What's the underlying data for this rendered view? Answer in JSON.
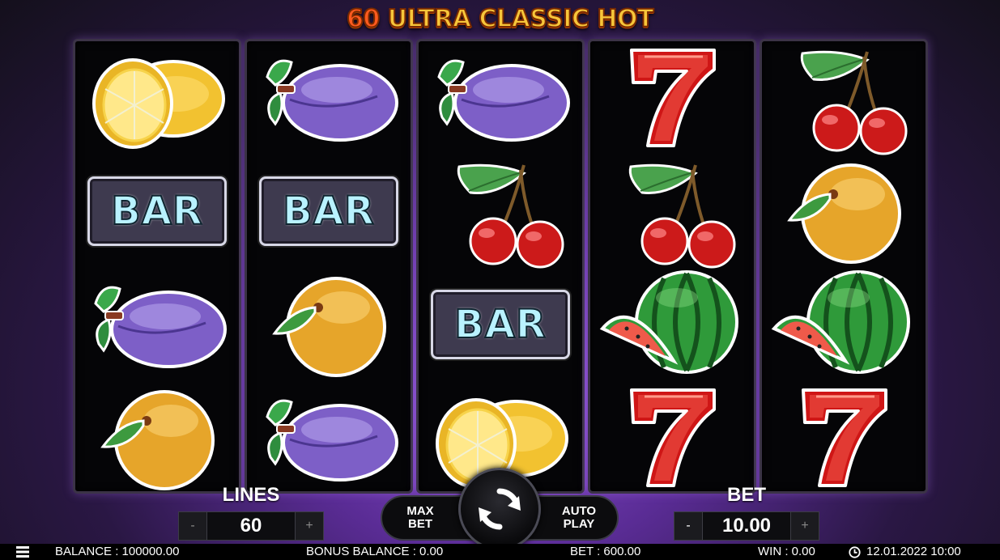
{
  "game": {
    "title_num": "60",
    "title_text": "ULTRA CLASSIC HOT"
  },
  "reels": [
    [
      "lemon",
      "bar",
      "plum",
      "orange"
    ],
    [
      "plum",
      "bar",
      "orange",
      "plum"
    ],
    [
      "plum",
      "cherry",
      "bar",
      "lemon"
    ],
    [
      "seven",
      "cherry",
      "watermelon",
      "seven"
    ],
    [
      "cherry",
      "orange",
      "watermelon",
      "seven"
    ]
  ],
  "symbols": {
    "bar_text": "BAR"
  },
  "controls": {
    "lines_label": "LINES",
    "lines_value": "60",
    "bet_label": "BET",
    "bet_value": "10.00",
    "minus": "-",
    "plus": "+",
    "max_bet": "MAX\nBET",
    "auto_play": "AUTO\nPLAY"
  },
  "status": {
    "balance": "BALANCE : 100000.00",
    "bonus_balance": "BONUS BALANCE : 0.00",
    "bet": "BET : 600.00",
    "win": "WIN : 0.00",
    "datetime": "12.01.2022 10:00"
  },
  "icons": {
    "menu": "hamburger-icon",
    "clock": "clock-icon",
    "spin": "refresh-icon"
  },
  "colors": {
    "title_gold": "#f7c63a",
    "bar_text": "#b9f2ff",
    "seven_red": "#d01818",
    "background_purple": "#8a4fd0"
  }
}
